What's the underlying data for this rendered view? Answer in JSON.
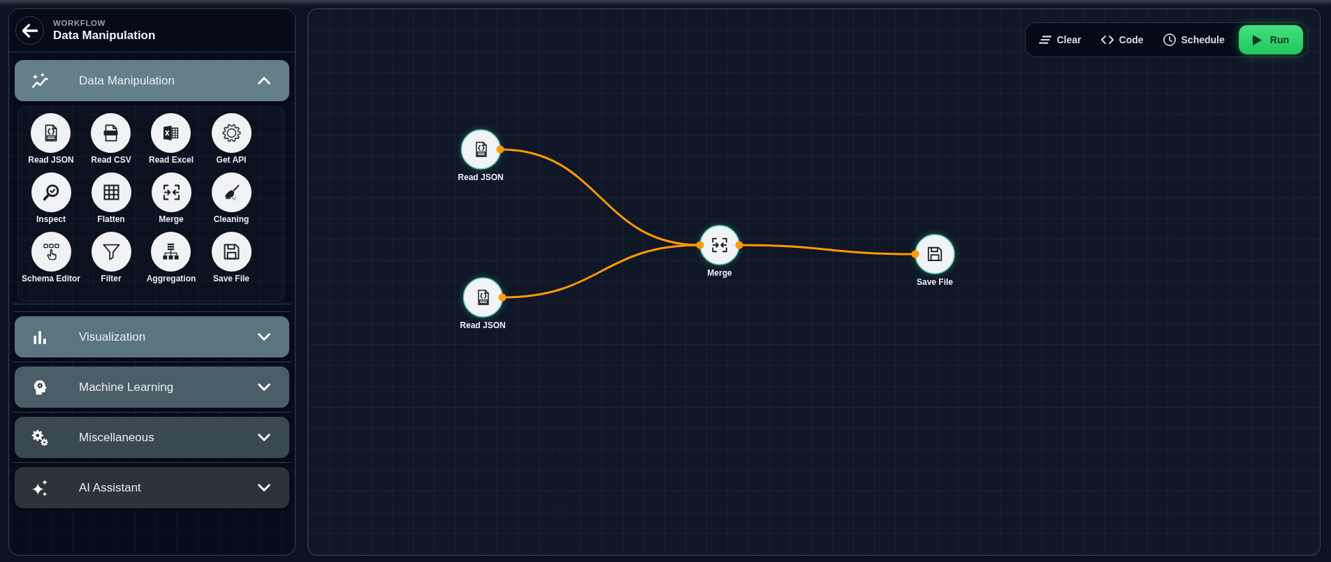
{
  "sidebar": {
    "header": {
      "eyebrow": "WORKFLOW",
      "title": "Data Manipulation"
    },
    "categories": [
      {
        "label": "Data Manipulation",
        "kind": "data",
        "expanded": true,
        "tools": [
          {
            "label": "Read JSON",
            "kind": "json"
          },
          {
            "label": "Read CSV",
            "kind": "csv"
          },
          {
            "label": "Read Excel",
            "kind": "excel"
          },
          {
            "label": "Get API",
            "kind": "api"
          },
          {
            "label": "Inspect",
            "kind": "inspect"
          },
          {
            "label": "Flatten",
            "kind": "flatten"
          },
          {
            "label": "Merge",
            "kind": "merge"
          },
          {
            "label": "Cleaning",
            "kind": "cleaning"
          },
          {
            "label": "Schema Editor",
            "kind": "schema"
          },
          {
            "label": "Filter",
            "kind": "filter"
          },
          {
            "label": "Aggregation",
            "kind": "aggregation"
          },
          {
            "label": "Save File",
            "kind": "save"
          }
        ]
      },
      {
        "label": "Visualization",
        "kind": "chart",
        "expanded": false
      },
      {
        "label": "Machine Learning",
        "kind": "ml",
        "expanded": false
      },
      {
        "label": "Miscellaneous",
        "kind": "misc",
        "expanded": false
      },
      {
        "label": "AI Assistant",
        "kind": "ai",
        "expanded": false
      }
    ]
  },
  "toolbar": {
    "buttons": [
      {
        "label": "Clear",
        "kind": "clear"
      },
      {
        "label": "Code",
        "kind": "code"
      },
      {
        "label": "Schedule",
        "kind": "schedule"
      },
      {
        "label": "Run",
        "kind": "run"
      }
    ]
  },
  "canvas": {
    "nodes": [
      {
        "label": "Read JSON",
        "kind": "json"
      },
      {
        "label": "Read JSON",
        "kind": "json"
      },
      {
        "label": "Merge",
        "kind": "merge"
      },
      {
        "label": "Save File",
        "kind": "save"
      }
    ]
  }
}
